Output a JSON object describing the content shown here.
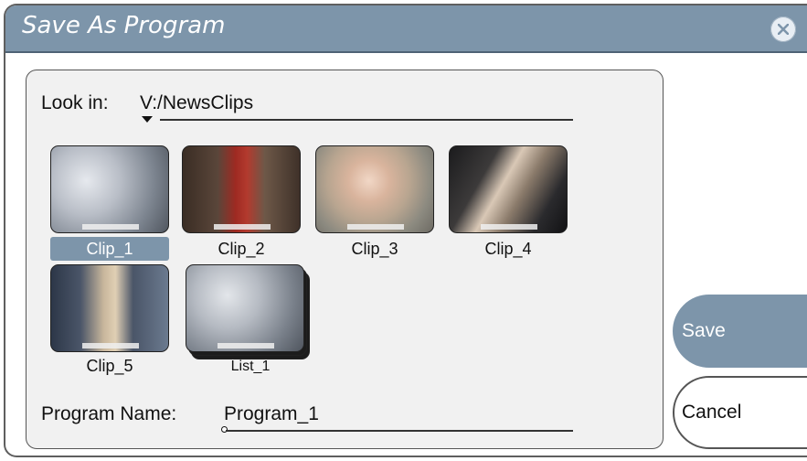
{
  "dialog": {
    "title": "Save As Program"
  },
  "look_in": {
    "label": "Look in:",
    "path": "V:/NewsClips"
  },
  "clips": [
    {
      "label": "Clip_1",
      "selected": true
    },
    {
      "label": "Clip_2",
      "selected": false
    },
    {
      "label": "Clip_3",
      "selected": false
    },
    {
      "label": "Clip_4",
      "selected": false
    },
    {
      "label": "Clip_5",
      "selected": false
    },
    {
      "label": "List_1",
      "selected": false
    }
  ],
  "program_name": {
    "label": "Program Name:",
    "value": "Program_1"
  },
  "buttons": {
    "save": "Save",
    "cancel": "Cancel"
  },
  "colors": {
    "titlebar": "#7d95aa",
    "selection": "#7d95aa",
    "panel": "#f1f1f1"
  },
  "icons": {
    "close": "close-icon"
  }
}
